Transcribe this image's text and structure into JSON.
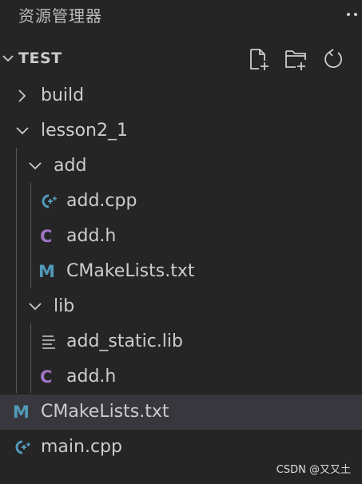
{
  "title_bar": {
    "title": "资源管理器",
    "more_icon": "ellipsis-icon"
  },
  "section": {
    "title": "TEST",
    "actions": [
      "new-file-icon",
      "new-folder-icon",
      "refresh-icon"
    ]
  },
  "tree": [
    {
      "label": "build",
      "kind": "folder",
      "expanded": false
    },
    {
      "label": "lesson2_1",
      "kind": "folder",
      "expanded": true
    },
    {
      "label": "add",
      "kind": "folder",
      "expanded": true
    },
    {
      "label": "add.cpp",
      "kind": "cpp"
    },
    {
      "label": "add.h",
      "kind": "c-header"
    },
    {
      "label": "CMakeLists.txt",
      "kind": "cmake"
    },
    {
      "label": "lib",
      "kind": "folder",
      "expanded": true
    },
    {
      "label": "add_static.lib",
      "kind": "text"
    },
    {
      "label": "add.h",
      "kind": "c-header"
    },
    {
      "label": "CMakeLists.txt",
      "kind": "cmake",
      "selected": true
    },
    {
      "label": "main.cpp",
      "kind": "cpp"
    }
  ],
  "icons": {
    "cpp_glyph": "C",
    "cpp_plus": "++",
    "c_header_glyph": "C",
    "cmake_glyph": "M"
  },
  "colors": {
    "background": "#252526",
    "selected_row": "#37373d",
    "cpp_icon": "#519aba",
    "c_header_icon": "#a074c4",
    "cmake_icon": "#519aba",
    "text": "#cccccc"
  },
  "watermark": "CSDN @又又土"
}
